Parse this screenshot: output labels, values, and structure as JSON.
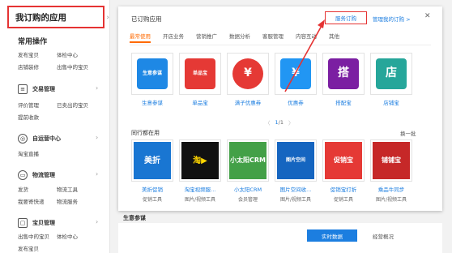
{
  "sidebar": {
    "my_apps": "我订购的应用",
    "common_ops": "常用操作",
    "common_items": [
      "发布宝贝",
      "体检中心",
      "店铺装修",
      "出售中的宝贝"
    ],
    "trade": {
      "title": "交易管理",
      "items": [
        "评价管理",
        "已卖出的宝贝",
        "提前收款"
      ]
    },
    "ops": {
      "title": "自运营中心",
      "items": [
        "淘宝直播"
      ]
    },
    "logistics": {
      "title": "物流管理",
      "items": [
        "发货",
        "物流工具",
        "我要寄快递",
        "物流服务"
      ]
    },
    "goods": {
      "title": "宝贝管理",
      "items": [
        "出售中的宝贝",
        "体检中心",
        "发布宝贝"
      ]
    }
  },
  "panel": {
    "title": "已订购应用",
    "service_order": "服务订购",
    "manage_link": "管理我的订购 >",
    "close": "✕",
    "tabs": [
      "最常使用",
      "开店业务",
      "营销推广",
      "数据分析",
      "客服管理",
      "内容互动",
      "其他"
    ],
    "subscribed": [
      {
        "name": "生意参谋",
        "logo": "生意参谋",
        "color": "#1e88e5"
      },
      {
        "name": "单品宝",
        "logo": "单品宝",
        "color": "#e53935"
      },
      {
        "name": "满子优惠券",
        "logo": "¥",
        "color": "#e53935"
      },
      {
        "name": "优惠券",
        "logo": "¥",
        "color": "#2196f3"
      },
      {
        "name": "搭配宝",
        "logo": "搭",
        "color": "#7b1fa2"
      },
      {
        "name": "店铺宝",
        "logo": "店",
        "color": "#26a69a"
      }
    ],
    "pager": {
      "prev": "〈",
      "current": "1",
      "total": "/1",
      "next": "〉"
    },
    "peers_title": "同行都在用",
    "refresh": "换一批",
    "peers": [
      {
        "logo": "美折",
        "name": "美折促销",
        "cat": "促销工具",
        "color": "#1976d2"
      },
      {
        "logo": "淘▶",
        "name": "淘宝视频服...",
        "cat": "图片/视频工具",
        "color": "#111111"
      },
      {
        "logo": "小太阳CRM",
        "name": "小太阳CRM",
        "cat": "会员管理",
        "color": "#43a047"
      },
      {
        "logo": "图片空间",
        "name": "图片空间收...",
        "cat": "图片/视频工具",
        "color": "#1565c0"
      },
      {
        "logo": "促销宝",
        "name": "促销宝打折",
        "cat": "促销工具",
        "color": "#e53935"
      },
      {
        "logo": "铺铺宝",
        "name": "乘品牛同步",
        "cat": "图片/视频工具",
        "color": "#c62828"
      }
    ]
  },
  "background": {
    "heading": "生意参谋",
    "realtime": "实时数据",
    "overview": "经营概况"
  },
  "annotation": {
    "arrow_color": "#e53333"
  }
}
